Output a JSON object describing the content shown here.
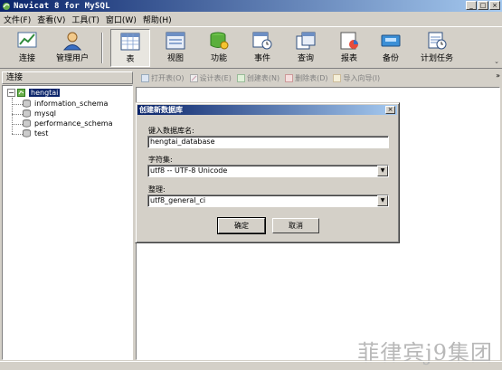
{
  "window": {
    "title": "Navicat 8 for MySQL",
    "minimize": "_",
    "maximize": "□",
    "close": "×"
  },
  "menu": [
    "文件(F)",
    "查看(V)",
    "工具(T)",
    "窗口(W)",
    "帮助(H)"
  ],
  "toolbar": {
    "items": [
      {
        "label": "连接"
      },
      {
        "label": "管理用户"
      },
      {
        "label": "表"
      },
      {
        "label": "视图"
      },
      {
        "label": "功能"
      },
      {
        "label": "事件"
      },
      {
        "label": "查询"
      },
      {
        "label": "报表"
      },
      {
        "label": "备份"
      },
      {
        "label": "计划任务"
      }
    ],
    "overflow": "⌄"
  },
  "left_pane": {
    "header": "连接",
    "root": {
      "expander": "−",
      "label": "hengtai"
    },
    "databases": [
      "information_schema",
      "mysql",
      "performance_schema",
      "test"
    ]
  },
  "right_toolbar": {
    "items": [
      "打开表(O)",
      "设计表(E)",
      "创建表(N)",
      "删除表(D)",
      "导入向导(I)"
    ],
    "chevron": "»"
  },
  "dialog": {
    "title": "创建新数据库",
    "close": "×",
    "name_label": "键入数据库名:",
    "name_value": "hengtai_database",
    "charset_label": "字符集:",
    "charset_value": "utf8 -- UTF-8 Unicode",
    "collation_label": "整理:",
    "collation_value": "utf8_general_ci",
    "ok": "确定",
    "cancel": "取消",
    "arrow": "▼"
  },
  "watermark": "菲律宾j9集团",
  "colors": {
    "titlebar": "#0a246a",
    "face": "#d4d0c8",
    "selection": "#0a246a"
  }
}
